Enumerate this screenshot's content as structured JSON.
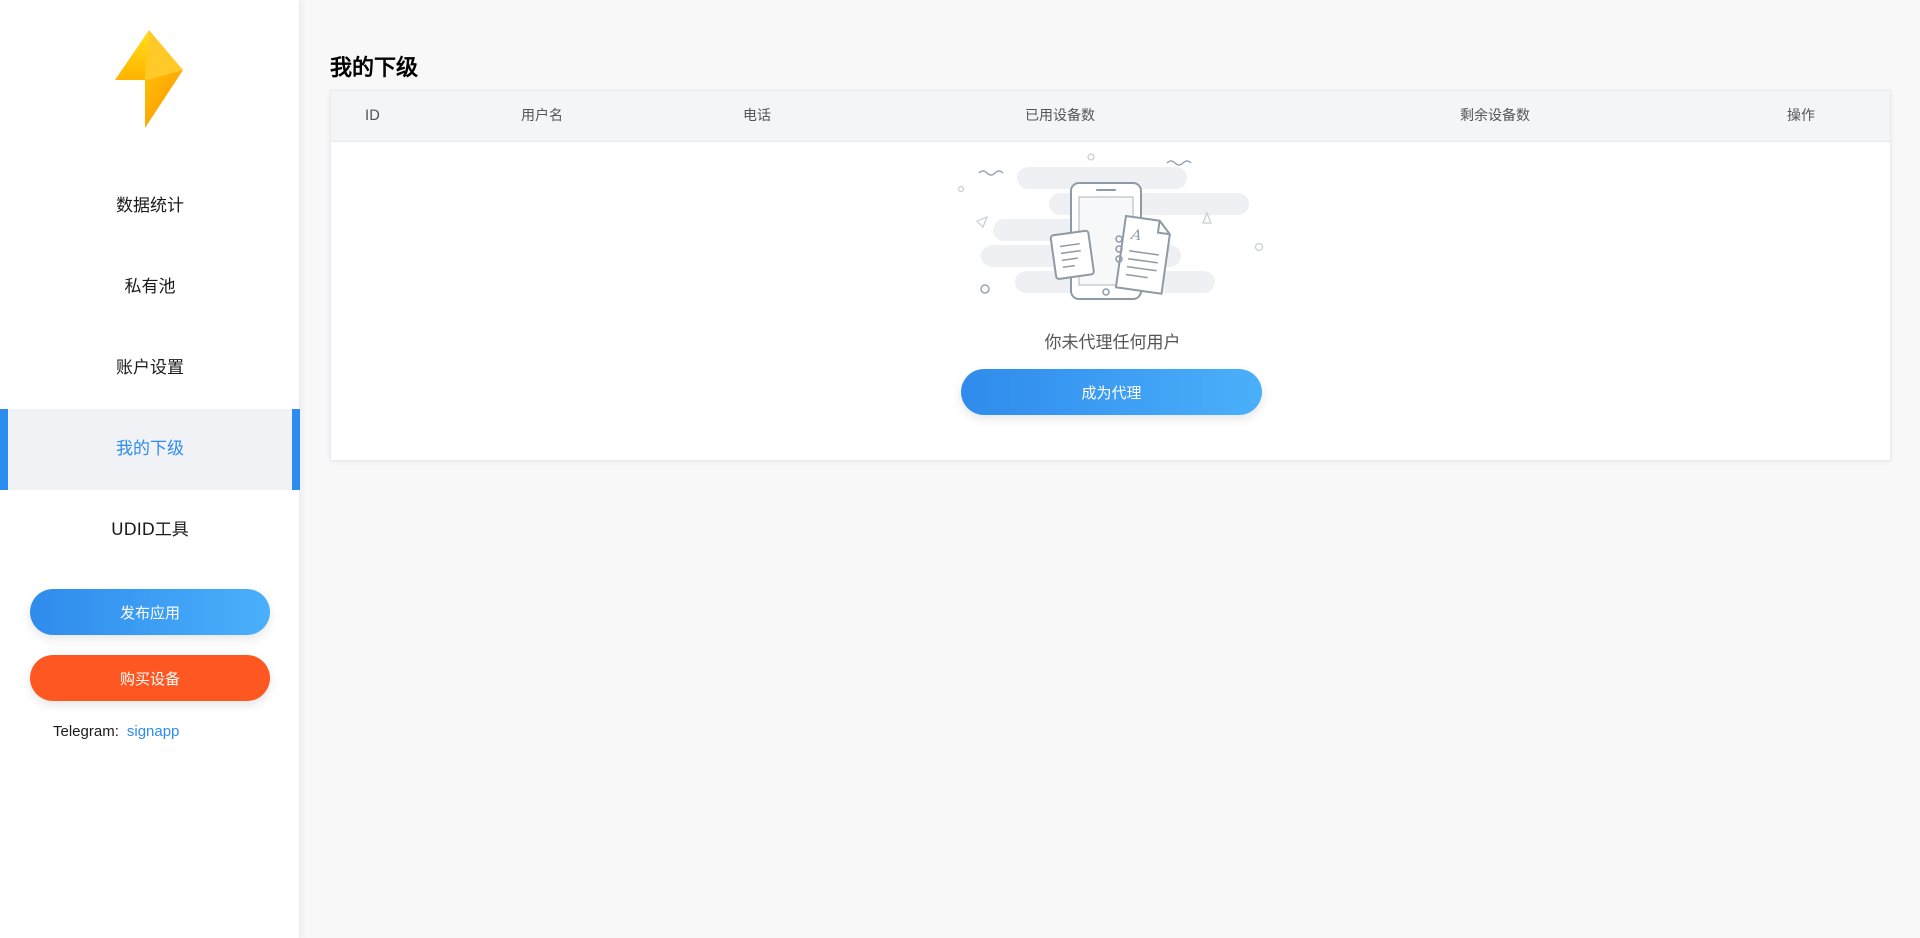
{
  "sidebar": {
    "items": [
      {
        "label": "数据统计",
        "active": false
      },
      {
        "label": "私有池",
        "active": false
      },
      {
        "label": "账户设置",
        "active": false
      },
      {
        "label": "我的下级",
        "active": true
      },
      {
        "label": "UDID工具",
        "active": false
      }
    ],
    "publish_label": "发布应用",
    "buy_label": "购买设备",
    "telegram_label": "Telegram:",
    "telegram_handle": "signapp"
  },
  "main": {
    "title": "我的下级",
    "table": {
      "columns": [
        "ID",
        "用户名",
        "电话",
        "已用设备数",
        "剩余设备数",
        "操作"
      ],
      "rows": []
    },
    "empty": {
      "message": "你未代理任何用户",
      "action_label": "成为代理"
    }
  },
  "colors": {
    "accent": "#2d8cf0",
    "buy": "#ff5722",
    "logo_top": "#ffd60a",
    "logo_bottom": "#ff9f0a"
  },
  "icons": {
    "logo": "lightning-bolt-icon",
    "empty_state": "empty-documents-illustration-icon"
  }
}
